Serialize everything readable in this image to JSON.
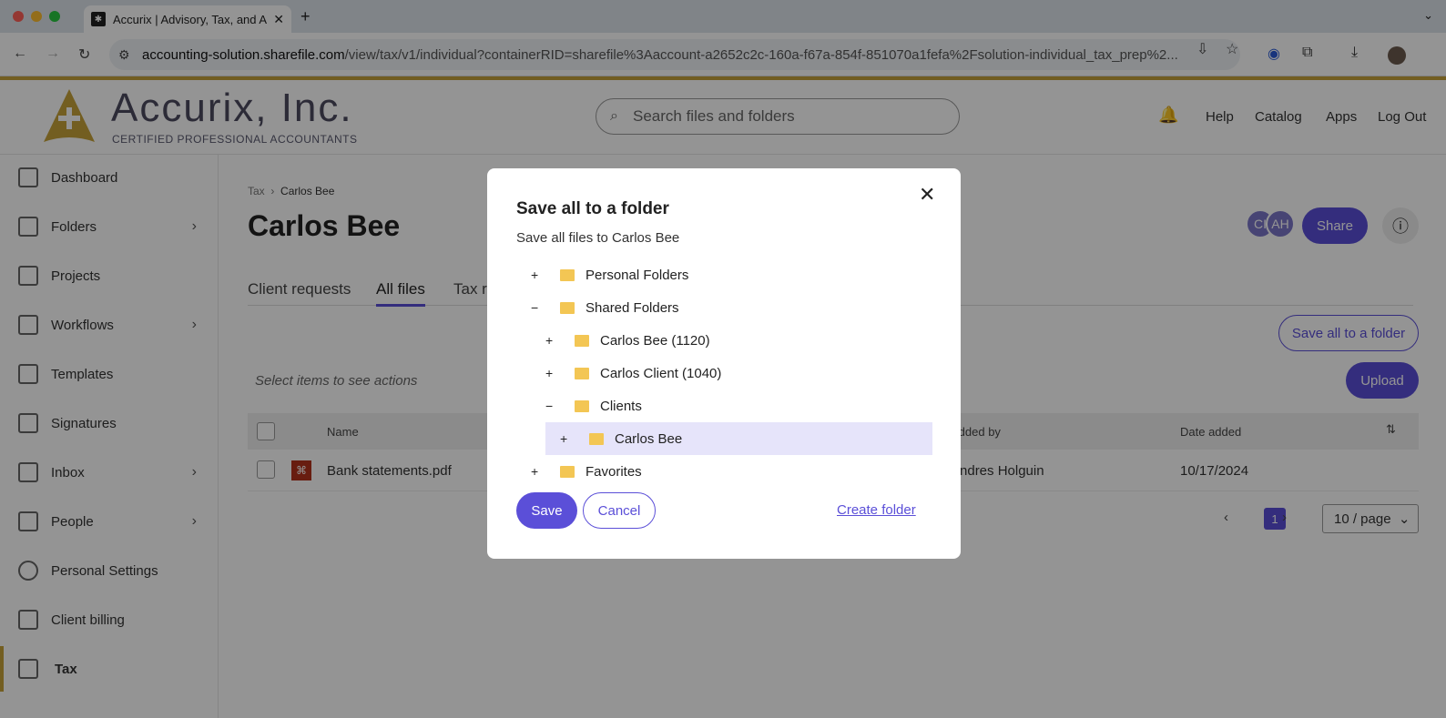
{
  "browser": {
    "tab_title": "Accurix | Advisory, Tax, and A",
    "url_host": "accounting-solution.sharefile.com",
    "url_path": "/view/tax/v1/individual?containerRID=sharefile%3Aaccount-a2652c2c-160a-f67a-854f-851070a1fefa%2Fsolution-individual_tax_prep%2..."
  },
  "header": {
    "brand": "Accurix, Inc.",
    "brand_sub": "CERTIFIED PROFESSIONAL ACCOUNTANTS",
    "search_placeholder": "Search files and folders",
    "nav": [
      "Help",
      "Catalog",
      "Apps",
      "Log Out"
    ]
  },
  "sidebar": {
    "items": [
      {
        "label": "Dashboard"
      },
      {
        "label": "Folders"
      },
      {
        "label": "Projects"
      },
      {
        "label": "Workflows"
      },
      {
        "label": "Templates"
      },
      {
        "label": "Signatures"
      },
      {
        "label": "Inbox"
      },
      {
        "label": "People"
      },
      {
        "label": "Personal Settings"
      },
      {
        "label": "Client billing"
      },
      {
        "label": "Tax"
      }
    ]
  },
  "main": {
    "breadcrumb": [
      "Tax",
      "Carlos Bee"
    ],
    "title": "Carlos Bee",
    "tabs": [
      "Client requests",
      "All files",
      "Tax r"
    ],
    "avatars": [
      "CI",
      "AH"
    ],
    "share_label": "Share",
    "save_all_label": "Save all to a folder",
    "upload_label": "Upload",
    "select_hint": "Select items to see actions",
    "columns": [
      "Name",
      "Added by",
      "Date added"
    ],
    "rows": [
      {
        "name": "Bank statements.pdf",
        "added_by": "Andres Holguin",
        "date": "10/17/2024"
      }
    ],
    "page": "1",
    "per_page": "10 / page"
  },
  "modal": {
    "title": "Save all to a folder",
    "subtitle": "Save all files to Carlos Bee",
    "tree": [
      {
        "label": "Personal Folders",
        "toggle": "+"
      },
      {
        "label": "Shared Folders",
        "toggle": "−"
      },
      {
        "label": "Carlos Bee (1120)",
        "toggle": "+"
      },
      {
        "label": "Carlos Client (1040)",
        "toggle": "+"
      },
      {
        "label": "Clients",
        "toggle": "−"
      },
      {
        "label": "Carlos Bee",
        "toggle": "+"
      },
      {
        "label": "Favorites",
        "toggle": "+"
      }
    ],
    "save_label": "Save",
    "cancel_label": "Cancel",
    "create_folder_label": "Create folder"
  },
  "colors": {
    "accent": "#5b4fd8",
    "brand_gold": "#c6a23a"
  }
}
